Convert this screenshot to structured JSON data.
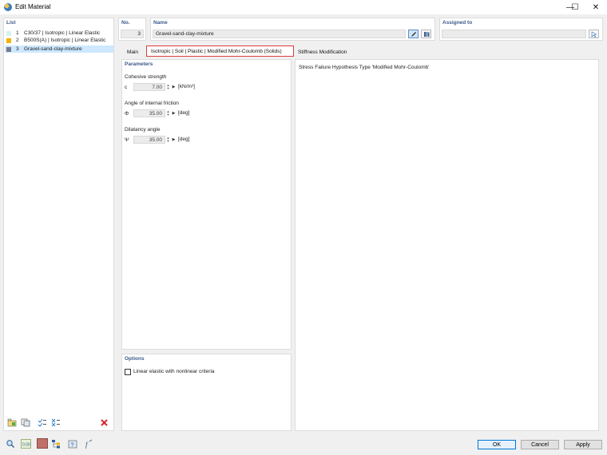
{
  "window": {
    "title": "Edit Material",
    "minimize": "—",
    "maximize": "☐",
    "close": "✕"
  },
  "list": {
    "header": "List",
    "items": [
      {
        "num": "1",
        "label": "C30/37 | Isotropic | Linear Elastic",
        "color": "#d7f2ee"
      },
      {
        "num": "2",
        "label": "B500S(A) | Isotropic | Linear Elastic",
        "color": "#f2b400"
      },
      {
        "num": "3",
        "label": "Gravel-sand-clay-mixture",
        "color": "#7a7a8c"
      }
    ]
  },
  "header": {
    "no_label": "No.",
    "no_value": "3",
    "name_label": "Name",
    "name_value": "Gravel-sand-clay-mixture",
    "assigned_label": "Assigned to",
    "assigned_value": ""
  },
  "tabs": [
    {
      "label": "Main"
    },
    {
      "label": "Isotropic | Soil | Plastic | Modified Mohr-Coulomb (Solids)"
    },
    {
      "label": "Stiffness Modification"
    }
  ],
  "parameters": {
    "title": "Parameters",
    "cohesive": {
      "label": "Cohesive strength",
      "symbol": "c",
      "value": "7.00",
      "unit": "[kN/m²]"
    },
    "friction": {
      "label": "Angle of internal friction",
      "symbol": "Φ",
      "value": "35.00",
      "unit": "[deg]"
    },
    "dilatancy": {
      "label": "Dilatancy angle",
      "symbol": "Ψ",
      "value": "35.00",
      "unit": "[deg]"
    }
  },
  "options": {
    "title": "Options",
    "linear_elastic": "Linear elastic with nonlinear criteria"
  },
  "info": {
    "text": "Stress Failure Hypothesis Type 'Modified Mohr-Coulomb'"
  },
  "buttons": {
    "ok": "OK",
    "cancel": "Cancel",
    "apply": "Apply"
  },
  "colors": {
    "selection": "#cde8ff",
    "tab_highlight": "#e03b3b",
    "accent_blue": "#3c5a8a",
    "delete_red": "#d9262c",
    "color_swatch": "#c0706a"
  }
}
